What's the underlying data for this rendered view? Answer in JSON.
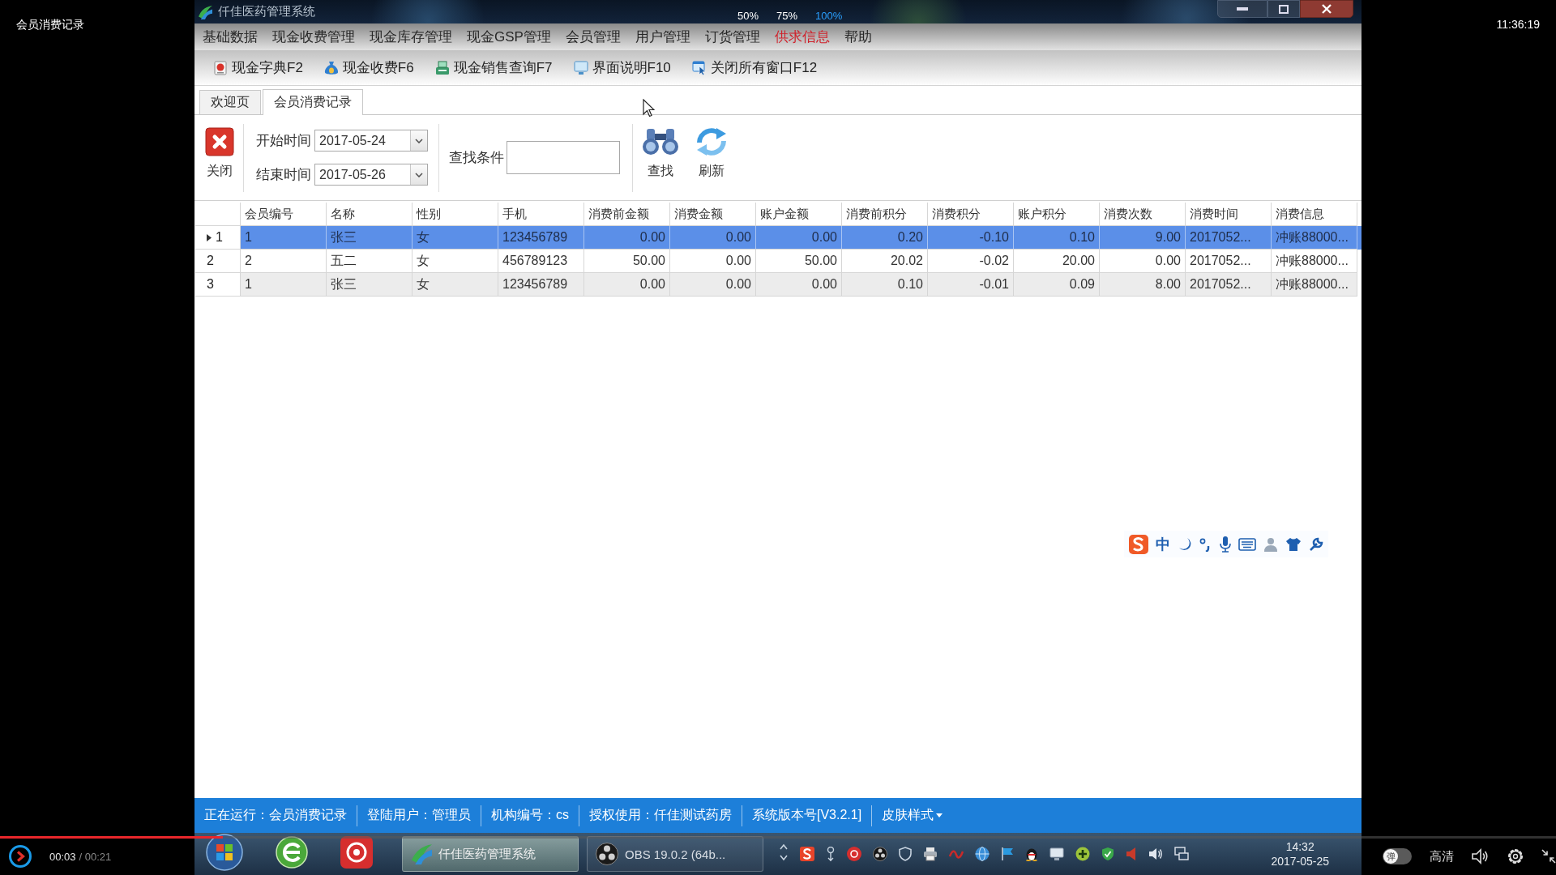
{
  "player": {
    "video_title": "会员消费记录",
    "clock": "11:36:19",
    "elapsed": "00:03",
    "duration": "/ 00:21",
    "level": 0.143,
    "toggle": {
      "label": "弹",
      "on": false
    },
    "quality": "高清"
  },
  "zoom_options": [
    {
      "label": "50%",
      "selected": false
    },
    {
      "label": "75%",
      "selected": false
    },
    {
      "label": "100%",
      "selected": true
    }
  ],
  "window": {
    "title": "仟佳医药管理系统"
  },
  "menu": [
    {
      "label": "基础数据",
      "highlighted": false
    },
    {
      "label": "现金收费管理",
      "highlighted": false
    },
    {
      "label": "现金库存管理",
      "highlighted": false
    },
    {
      "label": "现金GSP管理",
      "highlighted": false
    },
    {
      "label": "会员管理",
      "highlighted": false
    },
    {
      "label": "用户管理",
      "highlighted": false
    },
    {
      "label": "订货管理",
      "highlighted": false
    },
    {
      "label": "供求信息",
      "highlighted": true
    },
    {
      "label": "帮助",
      "highlighted": false
    }
  ],
  "toolbar": [
    {
      "label": "现金字典F2",
      "kind": "dictionary"
    },
    {
      "label": "现金收费F6",
      "kind": "moneybag"
    },
    {
      "label": "现金销售查询F7",
      "kind": "register"
    },
    {
      "label": "界面说明F10",
      "kind": "screen"
    },
    {
      "label": "关闭所有窗口F12",
      "kind": "windows"
    }
  ],
  "tabs": [
    {
      "label": "欢迎页",
      "selected": false
    },
    {
      "label": "会员消费记录",
      "selected": true
    }
  ],
  "filter": {
    "close_button": "关闭",
    "start_label": "开始时间",
    "start_date": "2017-05-24",
    "end_label": "结束时间",
    "end_date": "2017-05-26",
    "search_label": "查找条件",
    "search_button": "查找",
    "refresh_button": "刷新"
  },
  "table": {
    "columns": [
      {
        "label": "会员编号",
        "kind": "text"
      },
      {
        "label": "名称",
        "kind": "text"
      },
      {
        "label": "性别",
        "kind": "text"
      },
      {
        "label": "手机",
        "kind": "text"
      },
      {
        "label": "消费前金额",
        "kind": "number"
      },
      {
        "label": "消费金额",
        "kind": "number"
      },
      {
        "label": "账户金额",
        "kind": "number"
      },
      {
        "label": "消费前积分",
        "kind": "number"
      },
      {
        "label": "消费积分",
        "kind": "number"
      },
      {
        "label": "账户积分",
        "kind": "number"
      },
      {
        "label": "消费次数",
        "kind": "number"
      },
      {
        "label": "消费时间",
        "kind": "text"
      },
      {
        "label": "消费信息",
        "kind": "text"
      }
    ],
    "rows": [
      {
        "number": "1",
        "selected": true,
        "cells": [
          "1",
          "张三",
          "女",
          "123456789",
          "0.00",
          "0.00",
          "0.00",
          "0.20",
          "-0.10",
          "0.10",
          "9.00",
          "2017052...",
          "冲账88000..."
        ]
      },
      {
        "number": "2",
        "selected": false,
        "cells": [
          "2",
          "五二",
          "女",
          "456789123",
          "50.00",
          "0.00",
          "50.00",
          "20.02",
          "-0.02",
          "20.00",
          "0.00",
          "2017052...",
          "冲账88000..."
        ]
      },
      {
        "number": "3",
        "selected": false,
        "cells": [
          "1",
          "张三",
          "女",
          "123456789",
          "0.00",
          "0.00",
          "0.00",
          "0.10",
          "-0.01",
          "0.09",
          "8.00",
          "2017052...",
          "冲账88000..."
        ]
      }
    ]
  },
  "ime_toolbar": {
    "mode": "中"
  },
  "status_bar": [
    {
      "text": "正在运行：会员消费记录",
      "kind": "text"
    },
    {
      "text": "登陆用户：管理员",
      "kind": "text"
    },
    {
      "text": "机构编号：cs",
      "kind": "text"
    },
    {
      "text": "授权使用：仟佳测试药房",
      "kind": "text"
    },
    {
      "text": "系统版本号[V3.2.1]",
      "kind": "text"
    },
    {
      "text": "皮肤样式",
      "kind": "dropdown"
    }
  ],
  "taskbar": {
    "windows": [
      {
        "label": "仟佳医药管理系统",
        "kind": "app",
        "selected": true
      },
      {
        "label": "OBS 19.0.2 (64b...",
        "kind": "obs",
        "selected": false
      }
    ],
    "time": "14:32",
    "date": "2017-05-25"
  }
}
